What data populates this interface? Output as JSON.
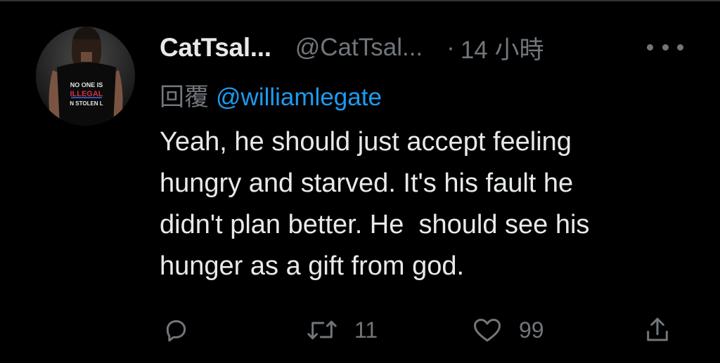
{
  "tweet": {
    "display_name": "CatTsal...",
    "handle": "@CatTsal...",
    "separator": "·",
    "time": "14 小時",
    "reply_prefix": "回覆",
    "reply_to": "@williamlegate",
    "text": "Yeah, he should just accept feeling\nhungry and starved. It's his fault he\ndidn't plan better. He  should see his\nhunger as a gift from god.",
    "avatar": {
      "shirt_text_line1": "NO ONE IS",
      "shirt_text_line2": "ILLEGAL",
      "shirt_text_line3": "N STOLEN L"
    }
  },
  "actions": {
    "reply": {
      "icon": "reply-icon",
      "count": ""
    },
    "retweet": {
      "icon": "retweet-icon",
      "count": "11"
    },
    "like": {
      "icon": "heart-icon",
      "count": "99"
    },
    "share": {
      "icon": "share-icon",
      "count": ""
    }
  },
  "colors": {
    "background": "#000000",
    "text_primary": "#e7e9ea",
    "text_secondary": "#71767b",
    "link": "#1d9bf0"
  }
}
